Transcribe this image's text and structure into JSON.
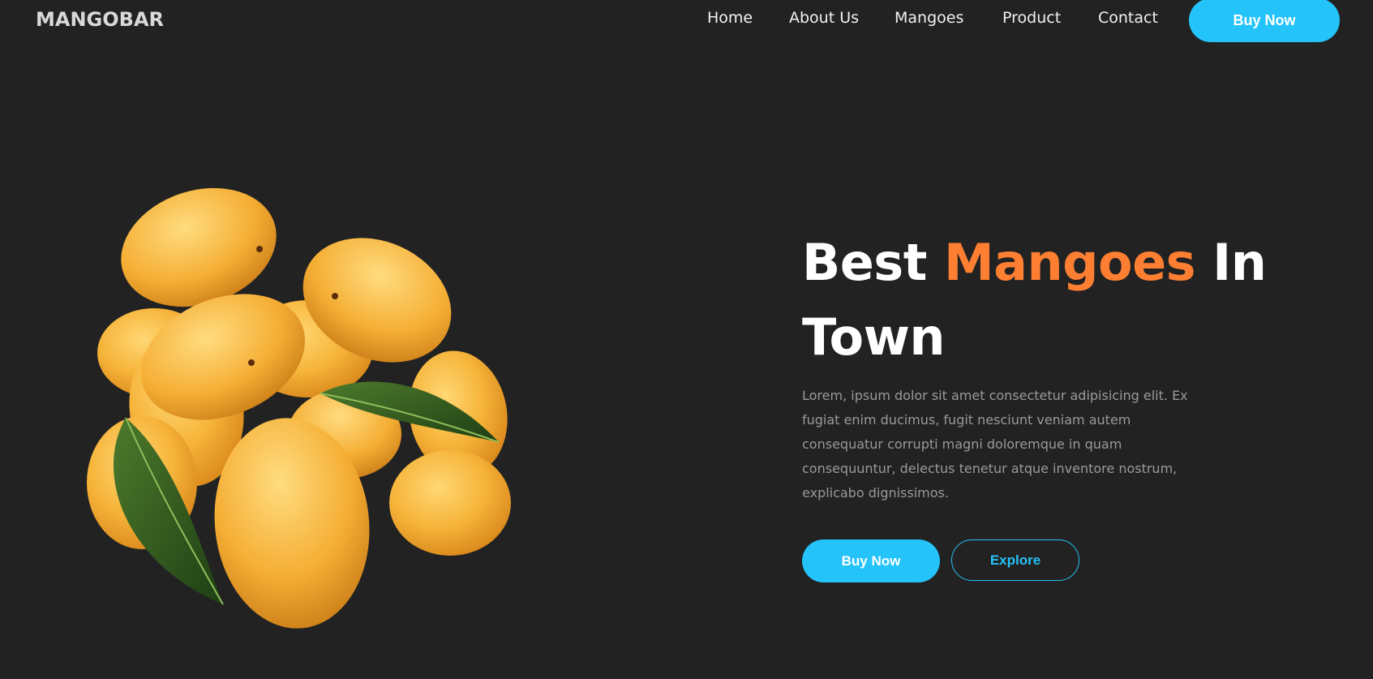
{
  "brand": {
    "name": "MANGOBAR"
  },
  "nav": {
    "items": [
      {
        "label": "Home"
      },
      {
        "label": "About Us"
      },
      {
        "label": "Mangoes"
      },
      {
        "label": "Product"
      },
      {
        "label": "Contact"
      }
    ],
    "cta_label": "Buy Now"
  },
  "hero": {
    "title_prefix": "Best ",
    "title_accent": "Mangoes",
    "title_suffix": " In Town",
    "description": "Lorem, ipsum dolor sit amet consectetur adipisicing elit. Ex fugiat enim ducimus, fugit nesciunt veniam autem consequatur corrupti magni doloremque in quam consequuntur, delectus tenetur atque inventore nostrum, explicabo dignissimos.",
    "primary_button": "Buy Now",
    "secondary_button": "Explore",
    "image_icon": "mango-pile-image"
  },
  "colors": {
    "background": "#222222",
    "accent_blue": "#24c3fa",
    "accent_orange": "#ff7f32",
    "text_light": "#ffffff",
    "text_muted": "#9a9a9a"
  }
}
